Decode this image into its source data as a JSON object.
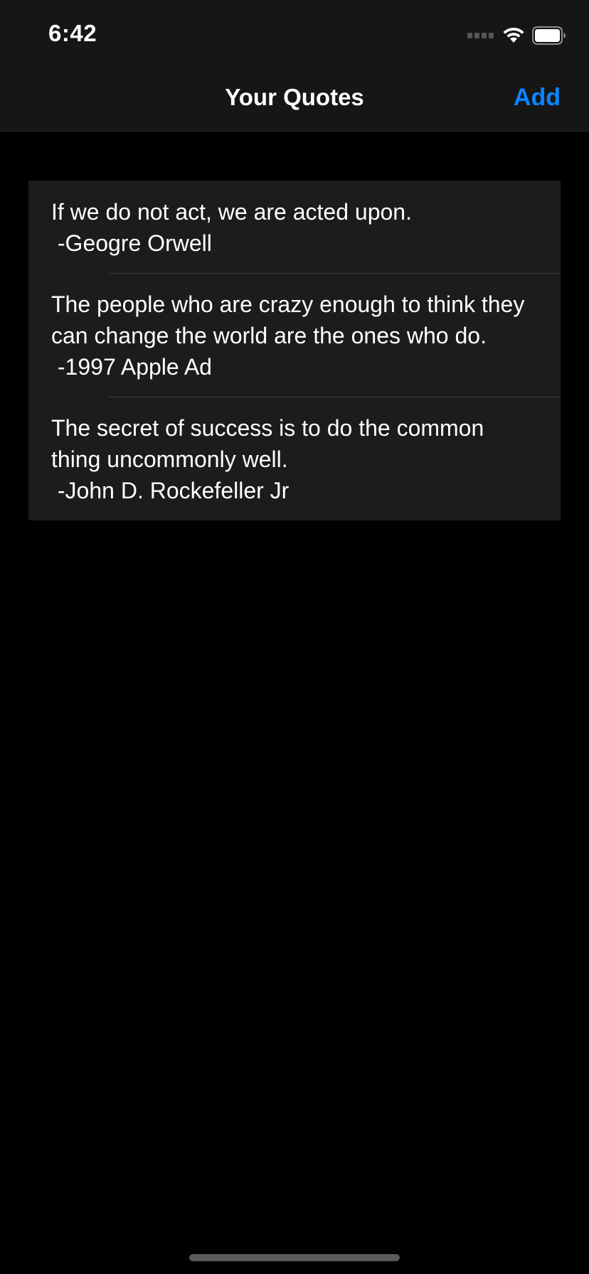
{
  "status_bar": {
    "time": "6:42",
    "signal_icon": "cellular-signal-icon",
    "wifi_icon": "wifi-icon",
    "battery_icon": "battery-icon"
  },
  "nav": {
    "title": "Your Quotes",
    "add_label": "Add"
  },
  "quotes": [
    {
      "text": "If we do not act, we are acted upon.",
      "author": " -Geogre Orwell"
    },
    {
      "text": "The people who are crazy enough to think they can change the world are the ones who do.",
      "author": " -1997 Apple Ad"
    },
    {
      "text": "The secret of success is to do the common thing uncommonly well.",
      "author": " -John D. Rockefeller Jr"
    }
  ],
  "colors": {
    "background": "#000000",
    "header": "#161616",
    "row_background": "#1c1c1e",
    "accent": "#0a84ff",
    "separator": "#38383a"
  }
}
